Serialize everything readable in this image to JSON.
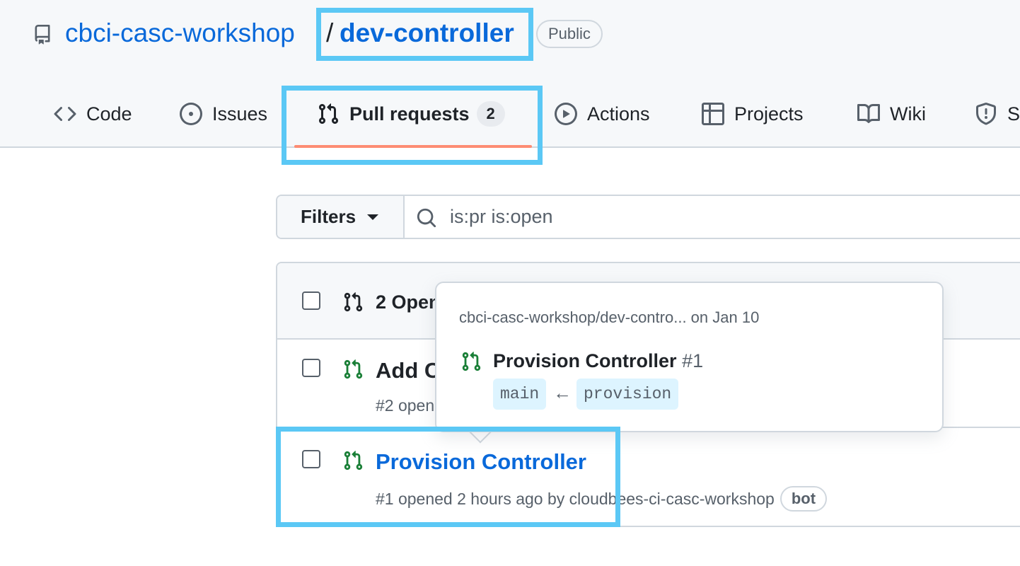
{
  "repo": {
    "owner": "cbci-casc-workshop",
    "separator": "/",
    "name": "dev-controller",
    "visibility": "Public"
  },
  "tabs": [
    {
      "label": "Code",
      "icon": "code-icon"
    },
    {
      "label": "Issues",
      "icon": "issue-opened-icon"
    },
    {
      "label": "Pull requests",
      "icon": "git-pull-request-icon",
      "counter": "2",
      "selected": true
    },
    {
      "label": "Actions",
      "icon": "play-icon"
    },
    {
      "label": "Projects",
      "icon": "table-icon"
    },
    {
      "label": "Wiki",
      "icon": "book-icon"
    },
    {
      "label": "S",
      "icon": "shield-icon"
    }
  ],
  "filters": {
    "button_label": "Filters",
    "search_value": "is:pr is:open"
  },
  "list": {
    "header_label": "2 Open",
    "rows": [
      {
        "title": "Add C",
        "meta": "#2 open"
      },
      {
        "title": "Provision Controller",
        "meta": "#1 opened 2 hours ago by cloudbees-ci-casc-workshop",
        "badge": "bot"
      }
    ]
  },
  "hovercard": {
    "repo_line": "cbci-casc-workshop/dev-contro... on Jan 10",
    "title": "Provision Controller",
    "number": "#1",
    "base_branch": "main",
    "arrow": "←",
    "head_branch": "provision"
  },
  "colors": {
    "link": "#0969da",
    "open_green": "#1a7f37",
    "tab_underline": "#fd8c73",
    "annotation": "#5bc8f5"
  }
}
